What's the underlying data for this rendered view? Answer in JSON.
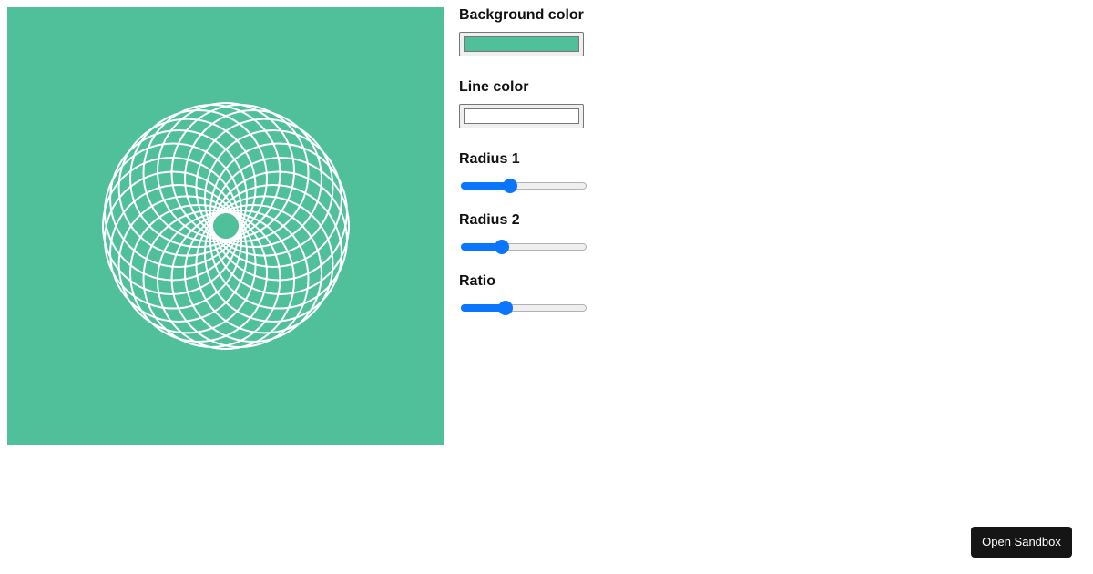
{
  "canvas": {
    "background_color": "#50c09a",
    "line_color": "#ffffff",
    "pattern_icon": "spirograph-pattern"
  },
  "controls": {
    "background_color": {
      "label": "Background color",
      "value": "#50c09a"
    },
    "line_color": {
      "label": "Line color",
      "value": "#ffffff"
    },
    "radius1": {
      "label": "Radius 1",
      "value_fraction": 0.38
    },
    "radius2": {
      "label": "Radius 2",
      "value_fraction": 0.3
    },
    "ratio": {
      "label": "Ratio",
      "value_fraction": 0.34
    }
  },
  "footer": {
    "open_sandbox_label": "Open Sandbox"
  },
  "colors": {
    "accent": "#0a75ff",
    "button_bg": "#151515"
  }
}
